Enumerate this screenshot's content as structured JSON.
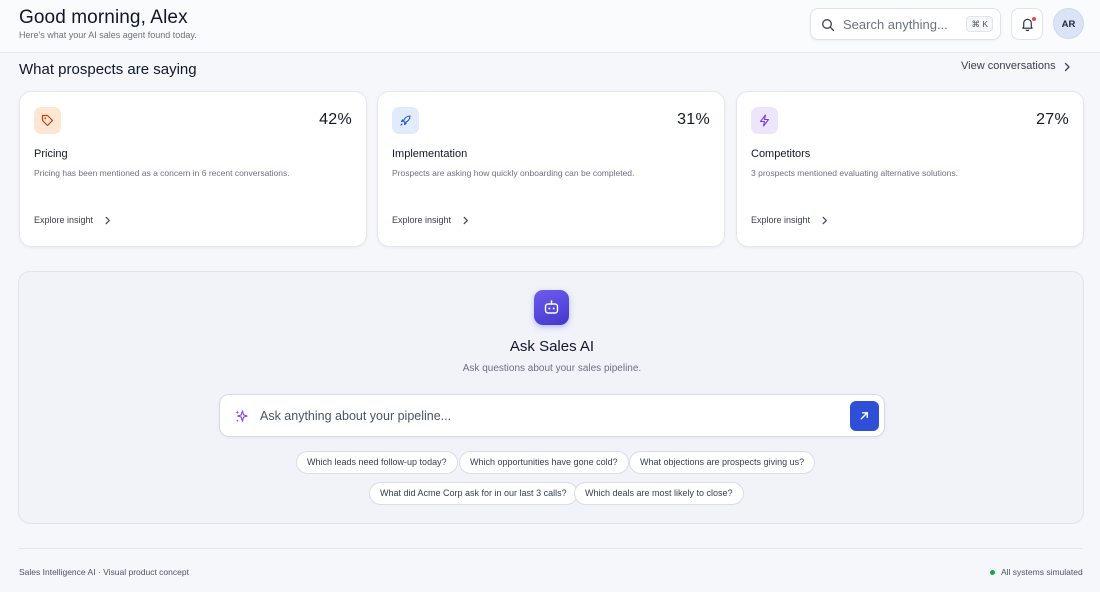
{
  "header": {
    "greeting": "Good morning, Alex",
    "subtitle": "Here's what your AI sales agent found today.",
    "search_placeholder": "Search anything...",
    "search_shortcut": "⌘ K",
    "avatar_initials": "AR"
  },
  "insights": {
    "title": "What prospects are saying",
    "view_link": "View conversations",
    "cards": [
      {
        "icon": "tag-icon",
        "percent": "42%",
        "title": "Pricing",
        "description": "Pricing has been mentioned as a concern in 6 recent conversations.",
        "link": "Explore insight",
        "accent": "#fde6d3"
      },
      {
        "icon": "rocket-icon",
        "percent": "31%",
        "title": "Implementation",
        "description": "Prospects are asking how quickly onboarding can be completed.",
        "link": "Explore insight",
        "accent": "#e0ecfb"
      },
      {
        "icon": "lightning-icon",
        "percent": "27%",
        "title": "Competitors",
        "description": "3 prospects mentioned evaluating alternative solutions.",
        "link": "Explore insight",
        "accent": "#ede6fb"
      }
    ]
  },
  "ask": {
    "title": "Ask Sales AI",
    "subtitle": "Ask questions about your sales pipeline.",
    "placeholder": "Ask anything about your pipeline...",
    "suggestions": [
      "Which leads need follow-up today?",
      "Which opportunities have gone cold?",
      "What objections are prospects giving us?",
      "What did Acme Corp ask for in our last 3 calls?",
      "Which deals are most likely to close?"
    ]
  },
  "footer": {
    "left": "Sales Intelligence AI · Visual product concept",
    "right": "All systems simulated",
    "status_color": "#16a34a"
  }
}
